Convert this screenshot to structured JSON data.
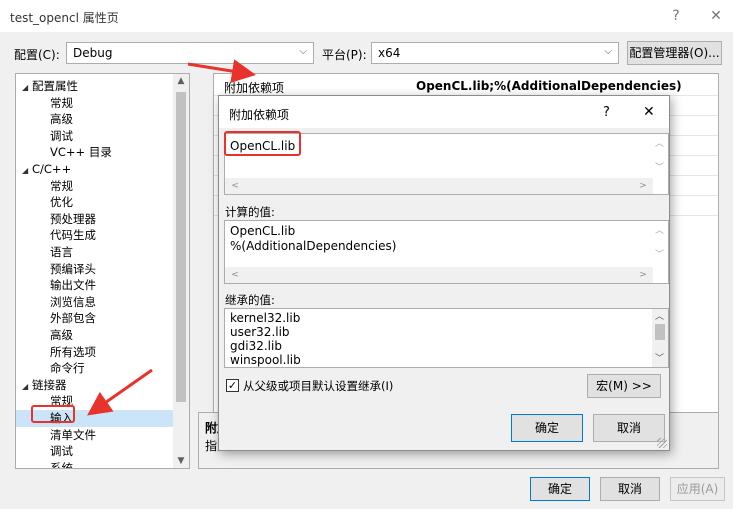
{
  "window": {
    "title": "test_opencl 属性页",
    "help": "?",
    "close": "✕"
  },
  "toolbar": {
    "config_label": "配置(C):",
    "config_value": "Debug",
    "platform_label": "平台(P):",
    "platform_value": "x64",
    "config_manager": "配置管理器(O)..."
  },
  "tree": {
    "items": [
      {
        "label": "配置属性",
        "toggle": "◢"
      },
      {
        "label": "常规"
      },
      {
        "label": "高级"
      },
      {
        "label": "调试"
      },
      {
        "label": "VC++ 目录"
      },
      {
        "label": "C/C++",
        "toggle": "◢"
      },
      {
        "label": "常规"
      },
      {
        "label": "优化"
      },
      {
        "label": "预处理器"
      },
      {
        "label": "代码生成"
      },
      {
        "label": "语言"
      },
      {
        "label": "预编译头"
      },
      {
        "label": "输出文件"
      },
      {
        "label": "浏览信息"
      },
      {
        "label": "外部包含"
      },
      {
        "label": "高级"
      },
      {
        "label": "所有选项"
      },
      {
        "label": "命令行"
      },
      {
        "label": "链接器",
        "toggle": "◢"
      },
      {
        "label": "常规"
      },
      {
        "label": "输入"
      },
      {
        "label": "清单文件"
      },
      {
        "label": "调试"
      },
      {
        "label": "系统"
      }
    ]
  },
  "grid": {
    "name": "附加依赖项",
    "value": "OpenCL.lib;%(AdditionalDependencies)"
  },
  "description": {
    "title": "附加",
    "text": "指定"
  },
  "dialog": {
    "title": "附加依赖项",
    "help": "?",
    "close": "✕",
    "input_text": "OpenCL.lib",
    "computed_label": "计算的值:",
    "computed_lines": [
      "OpenCL.lib",
      "%(AdditionalDependencies)"
    ],
    "inherited_label": "继承的值:",
    "inherited_lines": [
      "kernel32.lib",
      "user32.lib",
      "gdi32.lib",
      "winspool.lib"
    ],
    "inherit_checkbox": "从父级或项目默认设置继承(I)",
    "macro_button": "宏(M) >>",
    "ok": "确定",
    "cancel": "取消"
  },
  "footer": {
    "ok": "确定",
    "cancel": "取消",
    "apply": "应用(A)"
  },
  "colors": {
    "annotation_red": "#e8322c",
    "selection": "#cce4f7",
    "primary_border": "#0078d7"
  }
}
